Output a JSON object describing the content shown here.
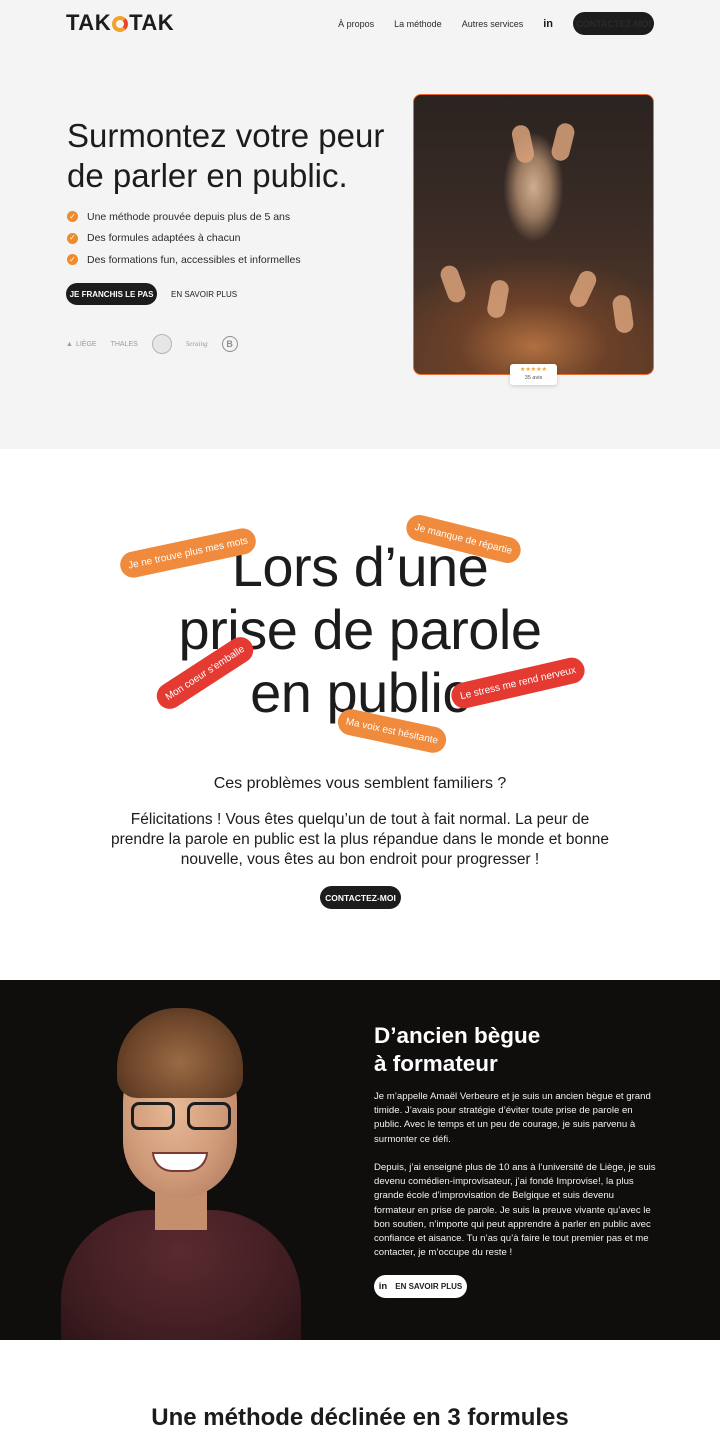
{
  "header": {
    "logo": "TAKOTAK",
    "nav": [
      "À propos",
      "La méthode",
      "Autres services"
    ],
    "linkedin": "in",
    "contact": "CONTACTEZ-MOI"
  },
  "hero": {
    "title": "Surmontez votre peur de parler en public.",
    "checks": [
      "Une méthode prouvée depuis plus de 5 ans",
      "Des formules adaptées à chacun",
      "Des formations fun, accessibles et informelles"
    ],
    "cta_primary": "JE FRANCHIS LE PAS",
    "cta_secondary": "EN SAVOIR PLUS",
    "clients": [
      "LIÈGE",
      "THALES",
      "Seraing",
      "B"
    ],
    "rating": {
      "stars": "★★★★★",
      "count": "35 avis"
    }
  },
  "problems": {
    "headline": [
      "Lors d’une",
      "prise de parole",
      "en public"
    ],
    "pills": [
      "Je ne trouve plus mes mots",
      "Je manque de répartie",
      "Mon coeur s'emballe",
      "Le stress me rend nerveux",
      "Ma voix est hésitante"
    ],
    "question": "Ces problèmes vous semblent familiers ?",
    "paragraph": "Félicitations ! Vous êtes quelqu’un de tout à fait normal. La peur de prendre la parole en public est la plus répandue dans le monde et bonne nouvelle, vous êtes au bon endroit pour progresser !",
    "cta": "CONTACTEZ-MOI"
  },
  "bio": {
    "title_line1": "D’ancien bègue",
    "title_line2": "à formateur",
    "p1": "Je m’appelle Amaël Verbeure et je suis un ancien bègue et grand timide. J’avais pour stratégie d’éviter toute prise de parole en public. Avec le temps et un peu de courage, je suis parvenu à surmonter ce défi.",
    "p2": "Depuis, j’ai enseigné plus de 10 ans à l’université de Liège, je suis devenu comédien-improvisateur, j’ai fondé Improvise!, la plus grande école d’improvisation de Belgique et suis devenu formateur en prise de parole. Je suis la preuve vivante qu’avec le bon soutien, n’importe qui peut apprendre à parler en public avec confiance et aisance. Tu n’as qu’à faire le tout premier pas et me contacter, je m’occupe du reste !",
    "cta_icon": "in",
    "cta": "EN SAVOIR PLUS"
  },
  "formulas": {
    "title": "Une méthode déclinée en 3 formules"
  }
}
